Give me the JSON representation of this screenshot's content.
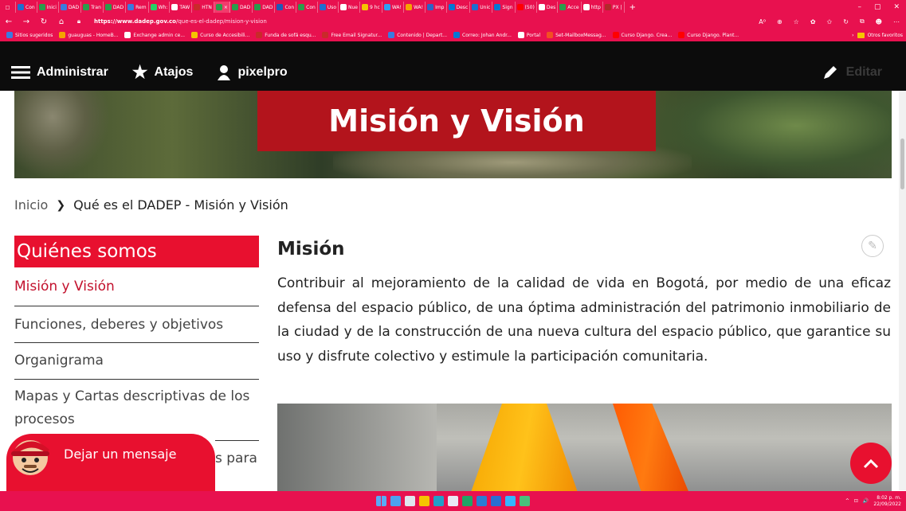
{
  "browser": {
    "tabs": [
      {
        "label": "Con",
        "color": "#1d6fd1"
      },
      {
        "label": "Inici",
        "color": "#2a9d4b"
      },
      {
        "label": "DAD",
        "color": "#3a7be0"
      },
      {
        "label": "Tran",
        "color": "#2a9d4b"
      },
      {
        "label": "DAD",
        "color": "#2a9d4b"
      },
      {
        "label": "Rem",
        "color": "#3a7be0"
      },
      {
        "label": "Wh:",
        "color": "#25d366"
      },
      {
        "label": "TAW",
        "color": "#ffffff"
      },
      {
        "label": "HTN",
        "color": "#c92a2a"
      },
      {
        "label": "×",
        "color": "#2a9d4b"
      },
      {
        "label": "DAD",
        "color": "#2a9d4b"
      },
      {
        "label": "DAD",
        "color": "#2a9d4b"
      },
      {
        "label": "Con",
        "color": "#1e5bb8"
      },
      {
        "label": "Con",
        "color": "#2a9d4b"
      },
      {
        "label": "Uso",
        "color": "#1d6fd1"
      },
      {
        "label": "Nue",
        "color": "#ffffff"
      },
      {
        "label": "9 hc",
        "color": "#f5c400"
      },
      {
        "label": "WA!",
        "color": "#2ea0f2"
      },
      {
        "label": "WA!",
        "color": "#f5a400"
      },
      {
        "label": "Imp",
        "color": "#2a65c8"
      },
      {
        "label": "Desc",
        "color": "#0078d4"
      },
      {
        "label": "Unic",
        "color": "#1d6fd1"
      },
      {
        "label": "Sign",
        "color": "#0078d4"
      },
      {
        "label": "(50)",
        "color": "#ff0000"
      },
      {
        "label": "Des",
        "color": "#ffffff"
      },
      {
        "label": "Acce",
        "color": "#2a9d4b"
      },
      {
        "label": "http",
        "color": "#ffffff"
      },
      {
        "label": "PX |",
        "color": "#b02a2a"
      }
    ],
    "new_tab": "+",
    "win_controls": [
      "–",
      "▢",
      "✕"
    ],
    "url_domain": "https://www.dadep.gov.co",
    "url_path": "/que-es-el-dadep/mision-y-vision",
    "addr_icons": [
      "A⁰",
      "⊕",
      "☆",
      "✿",
      "✩",
      "↻",
      "⧉",
      "☻",
      "⋯"
    ],
    "bookmarks": [
      {
        "label": "Sitios sugeridos",
        "color": "#3a7be0"
      },
      {
        "label": "guauguas - HomeB...",
        "color": "#f5a400"
      },
      {
        "label": "Exchange admin ce...",
        "color": "#ffffff"
      },
      {
        "label": "Curso de Accesibili...",
        "color": "#f5c400"
      },
      {
        "label": "Funda de sofá esqu...",
        "color": "#c92a2a"
      },
      {
        "label": "Free Email Signatur...",
        "color": "#c92a2a"
      },
      {
        "label": "Contenido | Depart...",
        "color": "#3a7be0"
      },
      {
        "label": "Correo: Johan Andr...",
        "color": "#0078d4"
      },
      {
        "label": "Portal",
        "color": "#ffffff"
      },
      {
        "label": "Set-MailboxMessag...",
        "color": "#f25022"
      },
      {
        "label": "Curso Django. Crea...",
        "color": "#ff0000"
      },
      {
        "label": "Curso Django. Plant...",
        "color": "#ff0000"
      }
    ],
    "other_favorites": "Otros favoritos"
  },
  "admin": {
    "manage": "Administrar",
    "shortcuts": "Atajos",
    "user": "pixelpro",
    "edit": "Editar"
  },
  "hero": {
    "title": "Misión y Visión"
  },
  "breadcrumb": {
    "home": "Inicio",
    "separator": "❯",
    "current": "Qué es el DADEP - Misión y Visión"
  },
  "sidebar": {
    "heading": "Quiénes somos",
    "items": [
      {
        "label": "Misión y Visión"
      },
      {
        "label": "Funciones, deberes y objetivos"
      },
      {
        "label": "Organigrama"
      },
      {
        "label": "Mapas y Cartas descriptivas de los procesos"
      }
    ],
    "partial_text": "s para"
  },
  "content": {
    "title": "Misión",
    "body": "Contribuir al mejoramiento de la calidad de vida en Bogotá, por medio de una eficaz defensa del espacio público, de una óptima administración del patrimonio inmobiliario de la ciudad y de la construcción de una nueva cultura del espacio público, que garantice su uso y disfrute colectivo y estimule la participación comunitaria."
  },
  "chat": {
    "label": "Dejar un mensaje"
  },
  "taskbar": {
    "apps": [
      "#4ea1f0",
      "#dfe6ee",
      "#f5c400",
      "#22a0c8",
      "#e9e9f5",
      "#21a366",
      "#2b7cd3",
      "#2b6ed1",
      "#35b6ff",
      "#48c27b"
    ],
    "time": "8:02 p. m.",
    "date": "22/09/2022",
    "tray_icons": [
      "^",
      "⊡",
      "🔊"
    ]
  }
}
